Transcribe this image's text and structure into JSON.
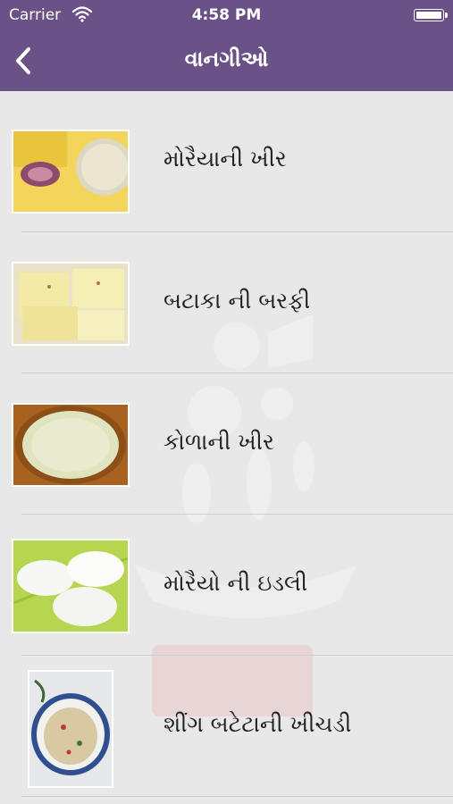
{
  "status_bar": {
    "carrier": "Carrier",
    "time": "4:58 PM",
    "battery_level": 1.0,
    "wifi_icon": "wifi-icon"
  },
  "nav": {
    "title": "વાનગીઓ",
    "back_icon": "chevron-left-icon"
  },
  "colors": {
    "bar": "#6b5286",
    "background": "#e8e8e8",
    "text": "#222222"
  },
  "recipes": [
    {
      "label": "મોરૈયાની ખીર",
      "image": "bowl of kheer with onion"
    },
    {
      "label": "બટાકા ની બરફી",
      "image": "potato barfi squares"
    },
    {
      "label": "કોળાની ખીર",
      "image": "bowl of pumpkin kheer"
    },
    {
      "label": "મોરૈયો ની ઇડલી",
      "image": "idli on banana leaf"
    },
    {
      "label": "શીંગ બટેટાની ખીચડી",
      "image": "bowl of khichdi"
    }
  ]
}
